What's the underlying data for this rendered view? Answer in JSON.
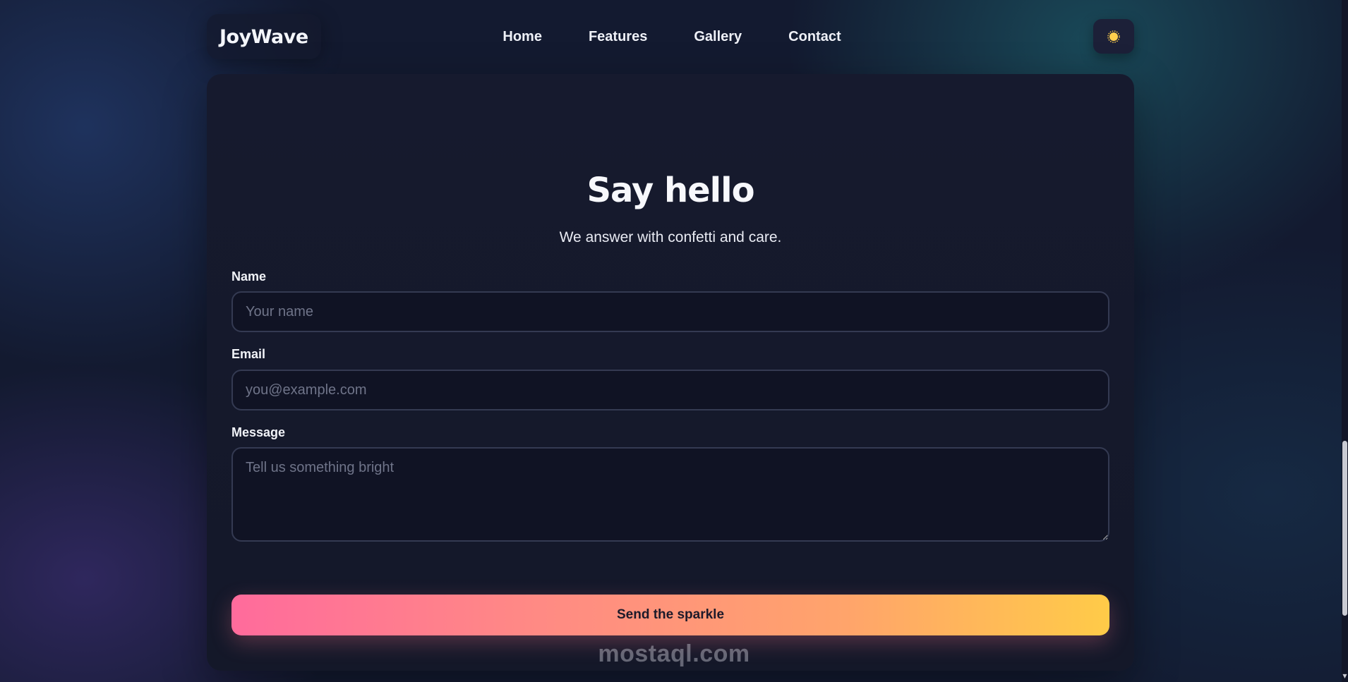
{
  "header": {
    "logo": "JoyWave",
    "nav": [
      "Home",
      "Features",
      "Gallery",
      "Contact"
    ],
    "theme_toggle_icon": "sun-icon",
    "theme_toggle_color": "#ffcf4d"
  },
  "form": {
    "title": "Say hello",
    "subtitle": "We answer with confetti and care.",
    "fields": {
      "name": {
        "label": "Name",
        "placeholder": "Your name",
        "value": ""
      },
      "email": {
        "label": "Email",
        "placeholder": "you@example.com",
        "value": ""
      },
      "message": {
        "label": "Message",
        "placeholder": "Tell us something bright",
        "value": ""
      }
    },
    "submit_label": "Send the sparkle"
  },
  "watermark": "mostaql.com",
  "colors": {
    "background": "#131a30",
    "card": "#161a2e",
    "button_gradient_start": "#ff6b9c",
    "button_gradient_end": "#ffcb48"
  }
}
